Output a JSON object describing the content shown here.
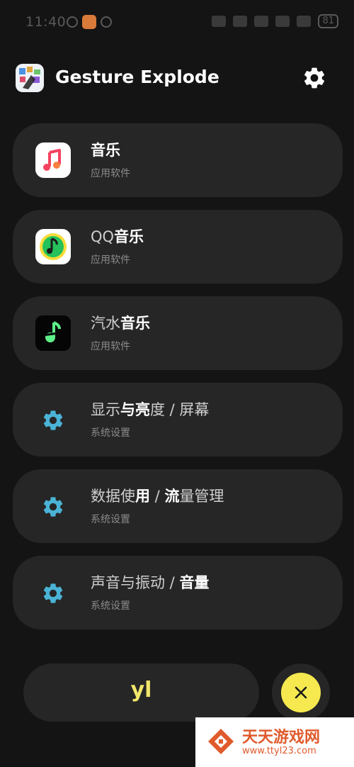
{
  "status_bar": {
    "time": "11:40",
    "battery": "81"
  },
  "header": {
    "title": "Gesture Explode"
  },
  "results": [
    {
      "title_parts": [
        {
          "t": "音乐",
          "b": true
        }
      ],
      "subtitle": "应用软件",
      "icon": "music-app-icon"
    },
    {
      "title_parts": [
        {
          "t": "QQ",
          "b": false
        },
        {
          "t": "音乐",
          "b": true
        }
      ],
      "subtitle": "应用软件",
      "icon": "qq-music-app-icon"
    },
    {
      "title_parts": [
        {
          "t": "汽水",
          "b": false
        },
        {
          "t": "音乐",
          "b": true
        }
      ],
      "subtitle": "应用软件",
      "icon": "qishui-music-app-icon"
    },
    {
      "title_parts": [
        {
          "t": "显示",
          "b": false
        },
        {
          "t": "与亮",
          "b": true
        },
        {
          "t": "度 / 屏幕",
          "b": false
        }
      ],
      "subtitle": "系统设置",
      "icon": "gear-icon"
    },
    {
      "title_parts": [
        {
          "t": "数据使",
          "b": false
        },
        {
          "t": "用",
          "b": true
        },
        {
          "t": " / ",
          "b": false
        },
        {
          "t": "流",
          "b": true
        },
        {
          "t": "量管理",
          "b": false
        }
      ],
      "subtitle": "系统设置",
      "icon": "gear-icon"
    },
    {
      "title_parts": [
        {
          "t": "声音与振动 / ",
          "b": false
        },
        {
          "t": "音量",
          "b": true
        }
      ],
      "subtitle": "系统设置",
      "icon": "gear-icon"
    }
  ],
  "query": {
    "text": "yl"
  },
  "watermark": {
    "name": "天天游戏网",
    "url": "www.ttyl23.com"
  },
  "colors": {
    "accent_yellow": "#f5e94f",
    "settings_gear": "#4ab3d6",
    "card_bg": "#262626"
  }
}
